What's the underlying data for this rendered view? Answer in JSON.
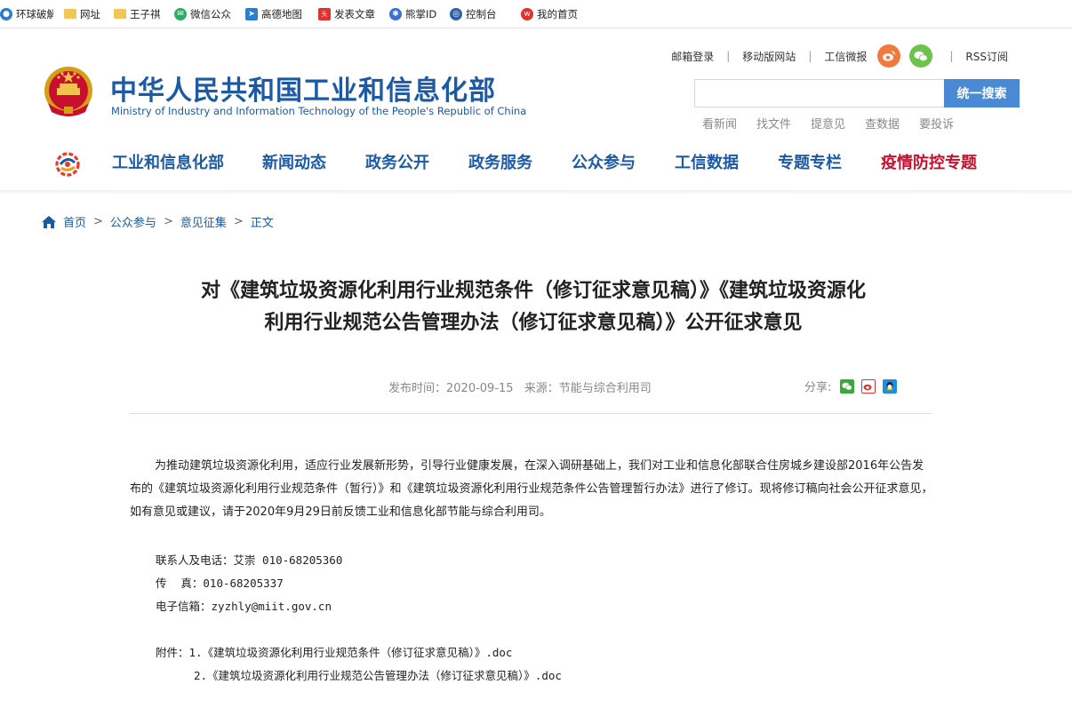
{
  "bookmarks": [
    {
      "label": "环球破解",
      "icon": "globe-icon",
      "color": "#2a7fd0"
    },
    {
      "label": "网址",
      "icon": "folder-icon",
      "color": "#e9b949"
    },
    {
      "label": "王子祺",
      "icon": "folder-icon",
      "color": "#e9b949"
    },
    {
      "label": "微信公众",
      "icon": "wechat-icon",
      "color": "#2aae67"
    },
    {
      "label": "高德地图",
      "icon": "map-icon",
      "color": "#2a7fd0"
    },
    {
      "label": "发表文章",
      "icon": "toutiao-icon",
      "color": "#e0322e"
    },
    {
      "label": "熊掌ID",
      "icon": "paw-icon",
      "color": "#3d6fd6"
    },
    {
      "label": "控制台",
      "icon": "console-icon",
      "color": "#2a5fb0"
    },
    {
      "label": "我的首页",
      "icon": "weibo-icon",
      "color": "#e0322e"
    }
  ],
  "header": {
    "top_links": [
      "邮箱登录",
      "移动版网站",
      "工信微报"
    ],
    "rss": "RSS订阅",
    "title": "中华人民共和国工业和信息化部",
    "subtitle": "Ministry of Industry and Information Technology of the People's Republic of China",
    "search": {
      "placeholder": "",
      "button": "统一搜索"
    },
    "quick_links": [
      "看新闻",
      "找文件",
      "提意见",
      "查数据",
      "要投诉"
    ]
  },
  "nav": {
    "items": [
      {
        "label": "工业和信息化部",
        "color": "#1c5aa6"
      },
      {
        "label": "新闻动态",
        "color": "#1c5aa6"
      },
      {
        "label": "政务公开",
        "color": "#1c5aa6"
      },
      {
        "label": "政务服务",
        "color": "#1c5aa6"
      },
      {
        "label": "公众参与",
        "color": "#1c5aa6"
      },
      {
        "label": "工信数据",
        "color": "#1c5aa6"
      },
      {
        "label": "专题专栏",
        "color": "#1c5aa6"
      },
      {
        "label": "疫情防控专题",
        "color": "#c8102e"
      }
    ]
  },
  "breadcrumb": [
    "首页",
    "公众参与",
    "意见征集",
    "正文"
  ],
  "article": {
    "title_line1": "对《建筑垃圾资源化利用行业规范条件（修订征求意见稿）》《建筑垃圾资源化",
    "title_line2": "利用行业规范公告管理办法（修订征求意见稿）》公开征求意见",
    "publish_label": "发布时间：2020-09-15",
    "source_label": "来源：节能与综合利用司",
    "share_label": "分享:",
    "body": "为推动建筑垃圾资源化利用，适应行业发展新形势，引导行业健康发展，在深入调研基础上，我们对工业和信息化部联合住房城乡建设部2016年公告发布的《建筑垃圾资源化利用行业规范条件（暂行）》和《建筑垃圾资源化利用行业规范条件公告管理暂行办法》进行了修订。现将修订稿向社会公开征求意见，如有意见或建议，请于2020年9月29日前反馈工业和信息化部节能与综合利用司。",
    "contact_label": "联系人及电话：",
    "contact_value": "艾崇  010-68205360",
    "fax_label": "传    真：",
    "fax_value": "010-68205337",
    "email_label": "电子信箱：",
    "email_value": "zyzhly@miit.gov.cn",
    "attach_label": "附件：",
    "attachment1": "1.《建筑垃圾资源化利用行业规范条件（修订征求意见稿）》.doc",
    "attachment2": "2.《建筑垃圾资源化利用行业规范公告管理办法（修订征求意见稿）》.doc"
  },
  "colors": {
    "brand_blue": "#1c5aa6",
    "search_button": "#4a8ad4",
    "alert_red": "#c8102e"
  }
}
